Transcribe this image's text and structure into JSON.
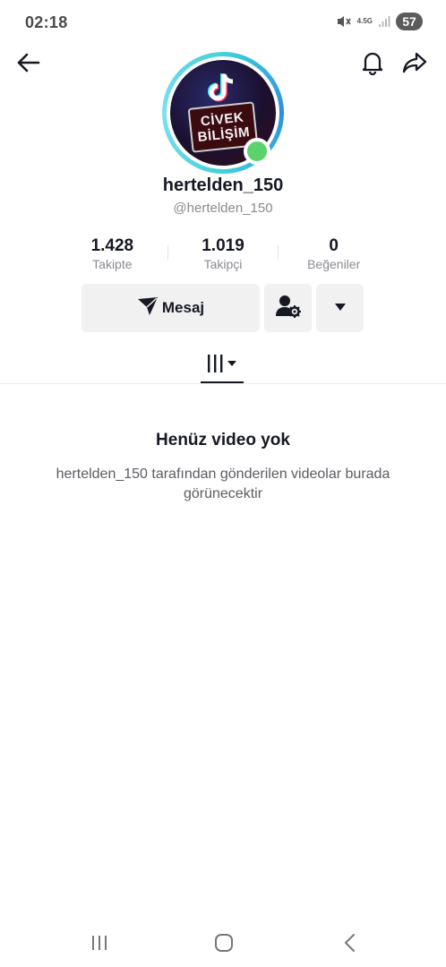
{
  "status_bar": {
    "time": "02:18",
    "network": "4.5G",
    "battery": "57",
    "icons": [
      "mute-icon",
      "signal-icon",
      "battery-icon"
    ]
  },
  "header": {
    "back_icon": "arrow-left-icon",
    "bell_icon": "bell-icon",
    "share_icon": "share-icon"
  },
  "profile": {
    "avatar_text": [
      "CİVEK",
      "BİLİŞİM"
    ],
    "display_name": "hertelden_150",
    "handle": "@hertelden_150",
    "online_color": "#5bd36c",
    "ring_color": "#43d1d8"
  },
  "stats": [
    {
      "value": "1.428",
      "label": "Takipte"
    },
    {
      "value": "1.019",
      "label": "Takipçi"
    },
    {
      "value": "0",
      "label": "Beğeniler"
    }
  ],
  "actions": {
    "message_label": "Mesaj",
    "message_icon": "send-icon",
    "user_settings_icon": "user-settings-icon",
    "more_icon": "caret-down-icon"
  },
  "tabs": {
    "videos_icon": "video-grid-icon"
  },
  "empty_state": {
    "title": "Henüz video yok",
    "description": "hertelden_150 tarafından gönderilen videolar burada görünecektir"
  },
  "nav_bar": {
    "icons": [
      "recents-icon",
      "home-icon",
      "back-icon"
    ]
  }
}
